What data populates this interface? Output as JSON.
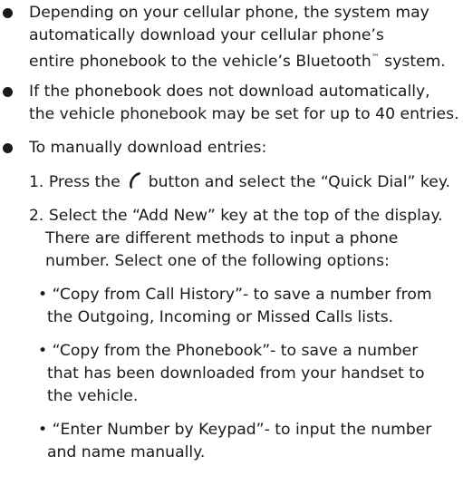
{
  "bullets": [
    {
      "lines": [
        "Depending on your cellular phone, the system may",
        "automatically download your cellular phone’s",
        "entire phonebook to the vehicle’s Bluetooth"
      ],
      "tm_mark": "™",
      "tm_after": " system."
    },
    {
      "lines": [
        "If the phonebook does not download automatically,",
        "the vehicle phonebook may be set for up to 40 entries."
      ]
    },
    {
      "lines": [
        "To manually download entries:"
      ]
    }
  ],
  "steps": [
    {
      "prefix": "1. Press the",
      "icon": "phone-handset-icon",
      "suffix": "button and select the “Quick Dial” key."
    },
    {
      "lines": [
        "2. Select the “Add New” key at the top of the display.",
        "There are different methods to input a phone",
        "number. Select one of the following options:"
      ]
    }
  ],
  "options": [
    {
      "lines": [
        "• “Copy from Call History”- to save a number from",
        "the Outgoing, Incoming or Missed Calls lists."
      ]
    },
    {
      "lines": [
        "• “Copy from the Phonebook”- to save a number",
        "that has been downloaded from your handset to",
        "the vehicle."
      ]
    },
    {
      "lines": [
        "• “Enter Number by Keypad”- to input the number",
        "and name manually."
      ]
    }
  ]
}
